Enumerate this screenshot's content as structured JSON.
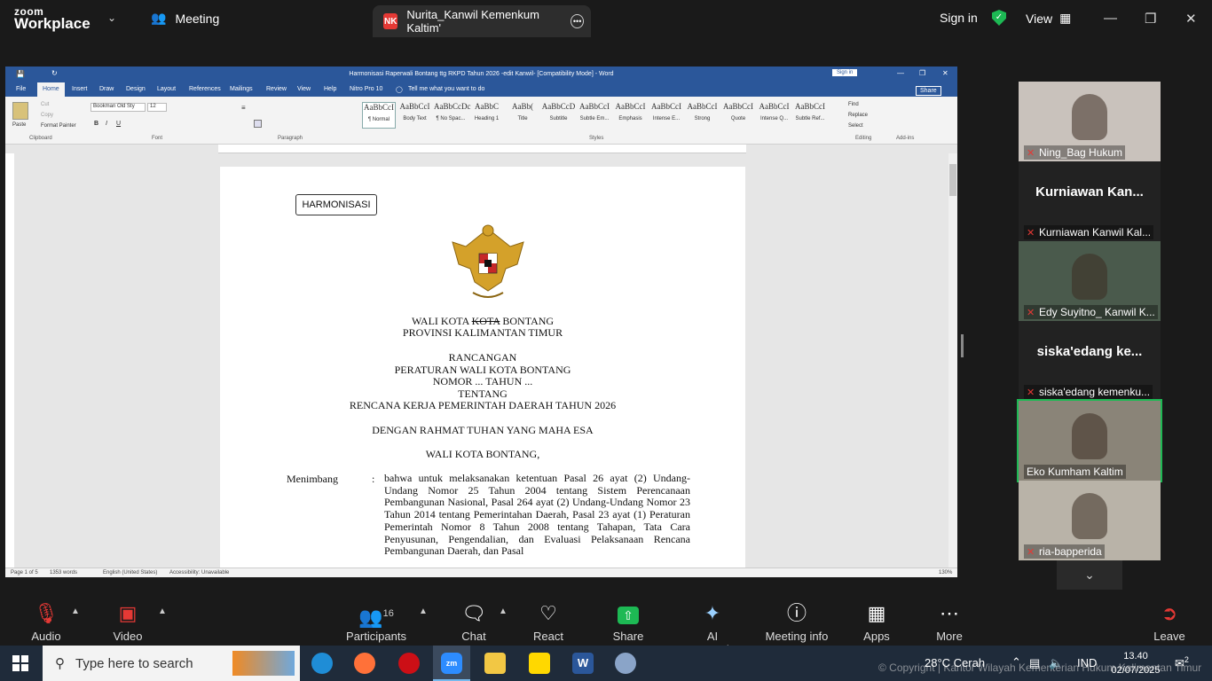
{
  "zoom": {
    "brand_line1": "zoom",
    "brand_line2": "Workplace",
    "meeting_label": "Meeting",
    "share_tab": {
      "initials": "NK",
      "title": "Nurita_Kanwil Kemenkum Kaltim'"
    },
    "sign_in": "Sign in",
    "view": "View",
    "accent": "#1db954"
  },
  "word": {
    "window_title": "Harmonisasi Raperwali Bontang ttg RKPD Tahun 2026 -edit Kanwil- [Compatibility Mode] - Word",
    "sign_in": "Sign in",
    "share": "Share",
    "tabs": [
      "File",
      "Home",
      "Insert",
      "Draw",
      "Design",
      "Layout",
      "References",
      "Mailings",
      "Review",
      "View",
      "Help",
      "Nitro Pro 10"
    ],
    "tell_me": "Tell me what you want to do",
    "font_name": "Bookman Old Sty",
    "font_size": "12",
    "clipboard": {
      "paste": "Paste",
      "cut": "Cut",
      "copy": "Copy",
      "format_painter": "Format Painter",
      "group": "Clipboard"
    },
    "groups": {
      "font": "Font",
      "paragraph": "Paragraph",
      "styles": "Styles",
      "editing": "Editing",
      "addins": "Add-ins"
    },
    "styles": [
      {
        "preview": "AaBbCcI",
        "name": "¶ Normal"
      },
      {
        "preview": "AaBbCcI",
        "name": "Body Text"
      },
      {
        "preview": "AaBbCcDc",
        "name": "¶ No Spac..."
      },
      {
        "preview": "AaBbC",
        "name": "Heading 1"
      },
      {
        "preview": "AaBb(",
        "name": "Title"
      },
      {
        "preview": "AaBbCcD",
        "name": "Subtitle"
      },
      {
        "preview": "AaBbCcI",
        "name": "Subtle Em..."
      },
      {
        "preview": "AaBbCcI",
        "name": "Emphasis"
      },
      {
        "preview": "AaBbCcI",
        "name": "Intense E..."
      },
      {
        "preview": "AaBbCcI",
        "name": "Strong"
      },
      {
        "preview": "AaBbCcI",
        "name": "Quote"
      },
      {
        "preview": "AaBbCcI",
        "name": "Intense Q..."
      },
      {
        "preview": "AaBbCcI",
        "name": "Subtle Ref..."
      }
    ],
    "editing": {
      "find": "Find",
      "replace": "Replace",
      "select": "Select"
    },
    "status": {
      "page": "Page 1 of 5",
      "words": "1353 words",
      "language": "English (United States)",
      "accessibility": "Accessibility: Unavailable",
      "zoom": "130%"
    }
  },
  "document": {
    "box_label": "HARMONISASI",
    "line1_a": "WALI KOTA ",
    "line1_struck": "KOTA",
    "line1_b": " BONTANG",
    "line2": "PROVINSI KALIMANTAN TIMUR",
    "line3": "RANCANGAN",
    "line4": "PERATURAN WALI KOTA BONTANG",
    "line5": "NOMOR ... TAHUN ...",
    "line6": "TENTANG",
    "line7": "RENCANA KERJA PEMERINTAH DAERAH TAHUN 2026",
    "line8": "DENGAN RAHMAT TUHAN YANG MAHA ESA",
    "line9": "WALI KOTA BONTANG,",
    "menimbang": "Menimbang",
    "colon": ":",
    "paragraph": "bahwa untuk melaksanakan ketentuan Pasal 26 ayat (2) Undang-Undang Nomor 25 Tahun 2004 tentang Sistem Perencanaan Pembangunan Nasional, Pasal 264 ayat (2) Undang-Undang Nomor 23 Tahun 2014 tentang Pemerintahan Daerah, Pasal 23 ayat (1) Peraturan Pemerintah Nomor 8 Tahun 2008 tentang Tahapan, Tata Cara Penyusunan, Pengendalian, dan Evaluasi Pelaksanaan Rencana Pembangunan Daerah, dan Pasal"
  },
  "participants": [
    {
      "name": "Ning_Bag Hukum",
      "type": "video",
      "bg": "#c9c2bc"
    },
    {
      "name": "Kurniawan Kanwil Kal...",
      "big": "Kurniawan  Kan...",
      "type": "name"
    },
    {
      "name": "Edy Suyitno_ Kanwil K...",
      "type": "video",
      "bg": "#4a5a4c"
    },
    {
      "name": "siska'edang kemenku...",
      "big": "siska'edang  ke...",
      "type": "name"
    },
    {
      "name": "Eko Kumham Kaltim",
      "type": "video",
      "bg": "#8a8478",
      "active": true
    },
    {
      "name": "ria-bapperida",
      "type": "video",
      "bg": "#b9b3a8"
    }
  ],
  "toolbar": {
    "audio": "Audio",
    "video": "Video",
    "participants": "Participants",
    "participants_count": "16",
    "chat": "Chat",
    "react": "React",
    "share": "Share",
    "ai": "AI Companion",
    "info": "Meeting info",
    "apps": "Apps",
    "more": "More",
    "leave": "Leave"
  },
  "taskbar": {
    "search_placeholder": "Type here to search",
    "weather": "28°C  Cerah",
    "lang": "IND",
    "time": "13.40",
    "date": "02/07/2025",
    "notifications": "2",
    "watermark": "© Copyright | Kantor Wilayah Kementerian Hukum Kalimantan Timur"
  }
}
